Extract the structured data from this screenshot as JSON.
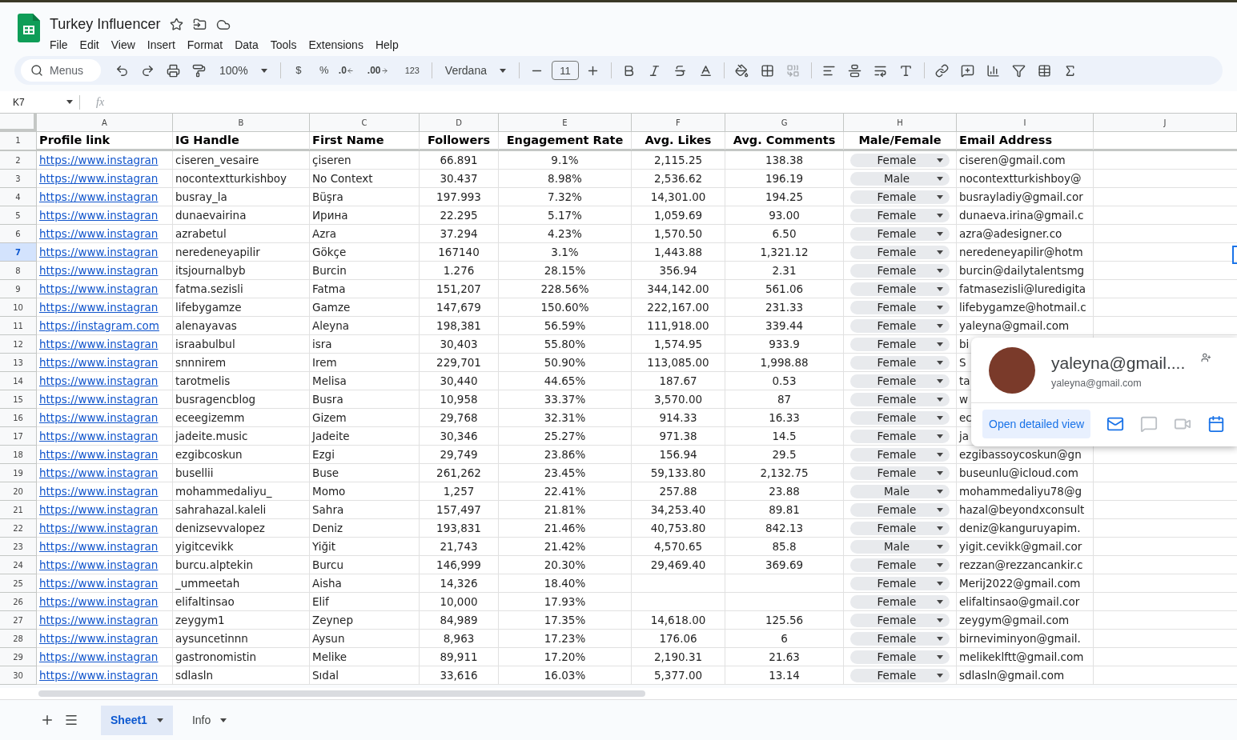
{
  "document": {
    "title": "Turkey Influencer",
    "menus": [
      "File",
      "Edit",
      "View",
      "Insert",
      "Format",
      "Data",
      "Tools",
      "Extensions",
      "Help"
    ]
  },
  "toolbar": {
    "search": {
      "placeholder": "Menus"
    },
    "zoom": "100%",
    "currency": "$",
    "percent": "%",
    "decrease_decimals": ".0",
    "increase_decimals": ".00",
    "number_format": "123",
    "font": "Verdana",
    "font_size": "11"
  },
  "formula_bar": {
    "cell_ref": "K7",
    "fx": "fx"
  },
  "columns": [
    "A",
    "B",
    "C",
    "D",
    "E",
    "F",
    "G",
    "H",
    "I",
    "J"
  ],
  "header_row": {
    "number": "1",
    "cells": [
      "Profile link",
      "IG Handle",
      "First Name",
      "Followers",
      "Engagement Rate",
      "Avg. Likes",
      "Avg. Comments",
      "Male/Female",
      "Email Address"
    ]
  },
  "rows": [
    {
      "number": "2",
      "selected": false,
      "link": "https://www.instagran",
      "handle": "ciseren_vesaire",
      "name": "çiseren",
      "followers": "66.891",
      "rate": "9.1%",
      "likes": "2,115.25",
      "comments": "138.38",
      "gender": "Female",
      "email": "ciseren@gmail.com"
    },
    {
      "number": "3",
      "selected": false,
      "link": "https://www.instagran",
      "handle": "nocontextturkishboy",
      "name": "No Context",
      "followers": "30.437",
      "rate": "8.98%",
      "likes": "2,536.62",
      "comments": "196.19",
      "gender": "Male",
      "email": "nocontextturkishboy@"
    },
    {
      "number": "4",
      "selected": false,
      "link": "https://www.instagran",
      "handle": "busray_la",
      "name": "Büşra",
      "followers": "197.993",
      "rate": "7.32%",
      "likes": "14,301.00",
      "comments": "194.25",
      "gender": "Female",
      "email": "busrayladiy@gmail.cor"
    },
    {
      "number": "5",
      "selected": false,
      "link": "https://www.instagran",
      "handle": "dunaevairina",
      "name": "Ирина",
      "followers": "22.295",
      "rate": "5.17%",
      "likes": "1,059.69",
      "comments": "93.00",
      "gender": "Female",
      "email": "dunaeva.irina@gmail.c"
    },
    {
      "number": "6",
      "selected": false,
      "link": "https://www.instagran",
      "handle": "azrabetul",
      "name": "Azra",
      "followers": "37.294",
      "rate": "4.23%",
      "likes": "1,570.50",
      "comments": "6.50",
      "gender": "Female",
      "email": "azra@adesigner.co"
    },
    {
      "number": "7",
      "selected": true,
      "link": "https://www.instagran",
      "handle": "neredeneyapilir",
      "name": "Gökçe",
      "followers": "167140",
      "rate": "3.1%",
      "likes": "1,443.88",
      "comments": "1,321.12",
      "gender": "Female",
      "email": "neredeneyapilir@hotm"
    },
    {
      "number": "8",
      "selected": false,
      "link": "https://www.instagran",
      "handle": "itsjournalbyb",
      "name": "Burcin",
      "followers": "1.276",
      "rate": "28.15%",
      "likes": "356.94",
      "comments": "2.31",
      "gender": "Female",
      "email": "burcin@dailytalentsmg"
    },
    {
      "number": "9",
      "selected": false,
      "link": "https://www.instagran",
      "handle": "fatma.sezisli",
      "name": "Fatma",
      "followers": "151,207",
      "rate": "228.56%",
      "likes": "344,142.00",
      "comments": "561.06",
      "gender": "Female",
      "email": "fatmasezisli@luredigita"
    },
    {
      "number": "10",
      "selected": false,
      "link": "https://www.instagran",
      "handle": "lifebygamze",
      "name": "Gamze",
      "followers": "147,679",
      "rate": "150.60%",
      "likes": "222,167.00",
      "comments": "231.33",
      "gender": "Female",
      "email": "lifebygamze@hotmail.c"
    },
    {
      "number": "11",
      "selected": false,
      "link": "https://instagram.com",
      "handle": "alenayavas",
      "name": "Aleyna",
      "followers": "198,381",
      "rate": "56.59%",
      "likes": "111,918.00",
      "comments": "339.44",
      "gender": "Female",
      "email": "yaleyna@gmail.com"
    },
    {
      "number": "12",
      "selected": false,
      "link": "https://www.instagran",
      "handle": "israabulbul",
      "name": "isra",
      "followers": "30,403",
      "rate": "55.80%",
      "likes": "1,574.95",
      "comments": "933.9",
      "gender": "Female",
      "email": "bi"
    },
    {
      "number": "13",
      "selected": false,
      "link": "https://www.instagran",
      "handle": "snnnirem",
      "name": "Irem",
      "followers": "229,701",
      "rate": "50.90%",
      "likes": "113,085.00",
      "comments": "1,998.88",
      "gender": "Female",
      "email": "S"
    },
    {
      "number": "14",
      "selected": false,
      "link": "https://www.instagran",
      "handle": "tarotmelis",
      "name": "Melisa",
      "followers": "30,440",
      "rate": "44.65%",
      "likes": "187.67",
      "comments": "0.53",
      "gender": "Female",
      "email": "ta"
    },
    {
      "number": "15",
      "selected": false,
      "link": "https://www.instagran",
      "handle": "busragencblog",
      "name": "Busra",
      "followers": "10,958",
      "rate": "33.37%",
      "likes": "3,570.00",
      "comments": "87",
      "gender": "Female",
      "email": "w"
    },
    {
      "number": "16",
      "selected": false,
      "link": "https://www.instagran",
      "handle": "eceegizemm",
      "name": "Gizem",
      "followers": "29,768",
      "rate": "32.31%",
      "likes": "914.33",
      "comments": "16.33",
      "gender": "Female",
      "email": "ec"
    },
    {
      "number": "17",
      "selected": false,
      "link": "https://www.instagran",
      "handle": "jadeite.music",
      "name": "Jadeite",
      "followers": "30,346",
      "rate": "25.27%",
      "likes": "971.38",
      "comments": "14.5",
      "gender": "Female",
      "email": "ja"
    },
    {
      "number": "18",
      "selected": false,
      "link": "https://www.instagran",
      "handle": "ezgibcoskun",
      "name": "Ezgi",
      "followers": "29,749",
      "rate": "23.86%",
      "likes": "156.94",
      "comments": "29.5",
      "gender": "Female",
      "email": "ezgibassoycoskun@gn"
    },
    {
      "number": "19",
      "selected": false,
      "link": "https://www.instagran",
      "handle": "busellii",
      "name": "Buse",
      "followers": "261,262",
      "rate": "23.45%",
      "likes": "59,133.80",
      "comments": "2,132.75",
      "gender": "Female",
      "email": "buseunlu@icloud.com"
    },
    {
      "number": "20",
      "selected": false,
      "link": "https://www.instagran",
      "handle": "mohammedaliyu_",
      "name": "Momo",
      "followers": "1,257",
      "rate": "22.41%",
      "likes": "257.88",
      "comments": "23.88",
      "gender": "Male",
      "email": "mohammedaliyu78@g"
    },
    {
      "number": "21",
      "selected": false,
      "link": "https://www.instagran",
      "handle": "sahrahazal.kaleli",
      "name": "Sahra",
      "followers": "157,497",
      "rate": "21.81%",
      "likes": "34,253.40",
      "comments": "89.81",
      "gender": "Female",
      "email": "hazal@beyondxconsult"
    },
    {
      "number": "22",
      "selected": false,
      "link": "https://www.instagran",
      "handle": "denizsevvalopez",
      "name": "Deniz",
      "followers": "193,831",
      "rate": "21.46%",
      "likes": "40,753.80",
      "comments": "842.13",
      "gender": "Female",
      "email": "deniz@kanguruyapim."
    },
    {
      "number": "23",
      "selected": false,
      "link": "https://www.instagran",
      "handle": "yigitcevikk",
      "name": "Yiğit",
      "followers": "21,743",
      "rate": "21.42%",
      "likes": "4,570.65",
      "comments": "85.8",
      "gender": "Male",
      "email": "yigit.cevikk@gmail.cor"
    },
    {
      "number": "24",
      "selected": false,
      "link": "https://www.instagran",
      "handle": "burcu.alptekin",
      "name": "Burcu",
      "followers": "146,999",
      "rate": "20.30%",
      "likes": "29,469.40",
      "comments": "369.69",
      "gender": "Female",
      "email": "rezzan@rezzancankir.c"
    },
    {
      "number": "25",
      "selected": false,
      "link": "https://www.instagran",
      "handle": "_ummeetah",
      "name": "Aisha",
      "followers": "14,326",
      "rate": "18.40%",
      "gender": "Female",
      "email": "Merij2022@gmail.com"
    },
    {
      "number": "26",
      "selected": false,
      "link": "https://www.instagran",
      "handle": "elifaltinsao",
      "name": "Elif",
      "followers": "10,000",
      "rate": "17.93%",
      "gender": "Female",
      "email": "elifaltinsao@gmail.cor"
    },
    {
      "number": "27",
      "selected": false,
      "link": "https://www.instagran",
      "handle": "zeygym1",
      "name": "Zeynep",
      "followers": "84,989",
      "rate": "17.35%",
      "likes": "14,618.00",
      "comments": "125.56",
      "gender": "Female",
      "email": "zeygym@gmail.com"
    },
    {
      "number": "28",
      "selected": false,
      "link": "https://www.instagran",
      "handle": "aysuncetinnn",
      "name": "Aysun",
      "followers": "8,963",
      "rate": "17.23%",
      "likes": "176.06",
      "comments": "6",
      "gender": "Female",
      "email": "birneviminyon@gmail."
    },
    {
      "number": "29",
      "selected": false,
      "link": "https://www.instagran",
      "handle": "gastronomistin",
      "name": "Melike",
      "followers": "89,911",
      "rate": "17.20%",
      "likes": "2,190.31",
      "comments": "21.63",
      "gender": "Female",
      "email": "melikeklftt@gmail.com"
    },
    {
      "number": "30",
      "selected": false,
      "link": "https://www.instagran",
      "handle": "sdlasln",
      "name": "Sıdal",
      "followers": "33,616",
      "rate": "16.03%",
      "likes": "5,377.00",
      "comments": "13.14",
      "gender": "Female",
      "email": "sdlasln@gmail.com"
    }
  ],
  "contact_card": {
    "name": "yaleyna@gmail....",
    "email": "yaleyna@gmail.com",
    "button": "Open detailed view"
  },
  "sheet_tabs": [
    {
      "label": "Sheet1",
      "selected": true
    },
    {
      "label": "Info",
      "selected": false
    }
  ]
}
